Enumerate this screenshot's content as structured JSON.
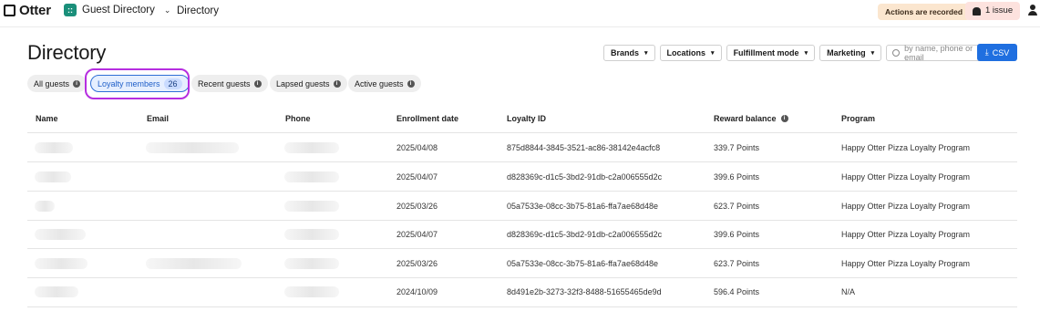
{
  "topbar": {
    "logo_text": "Otter",
    "app_name": "Guest Directory",
    "app_icon_glyph": "::",
    "breadcrumb": "Directory",
    "recorded_label": "Actions are recorded",
    "issue_label": "1 issue"
  },
  "page": {
    "title": "Directory"
  },
  "filters": {
    "brands": "Brands",
    "locations": "Locations",
    "fulfillment": "Fulfillment mode",
    "marketing": "Marketing",
    "search_placeholder": "by name, phone or email",
    "csv_label": "CSV"
  },
  "tabs": [
    {
      "label": "All guests"
    },
    {
      "label": "Loyalty members",
      "count": "26"
    },
    {
      "label": "Recent guests"
    },
    {
      "label": "Lapsed guests"
    },
    {
      "label": "Active guests"
    }
  ],
  "table": {
    "columns": [
      "Name",
      "Email",
      "Phone",
      "Enrollment date",
      "Loyalty ID",
      "Reward balance",
      "Program"
    ],
    "rows": [
      {
        "enrollment_date": "2025/04/08",
        "loyalty_id": "875d8844-3845-3521-ac86-38142e4acfc8",
        "reward_balance": "339.7 Points",
        "program": "Happy Otter Pizza Loyalty Program"
      },
      {
        "enrollment_date": "2025/04/07",
        "loyalty_id": "d828369c-d1c5-3bd2-91db-c2a006555d2c",
        "reward_balance": "399.6 Points",
        "program": "Happy Otter Pizza Loyalty Program"
      },
      {
        "enrollment_date": "2025/03/26",
        "loyalty_id": "05a7533e-08cc-3b75-81a6-ffa7ae68d48e",
        "reward_balance": "623.7 Points",
        "program": "Happy Otter Pizza Loyalty Program"
      },
      {
        "enrollment_date": "2025/04/07",
        "loyalty_id": "d828369c-d1c5-3bd2-91db-c2a006555d2c",
        "reward_balance": "399.6 Points",
        "program": "Happy Otter Pizza Loyalty Program"
      },
      {
        "enrollment_date": "2025/03/26",
        "loyalty_id": "05a7533e-08cc-3b75-81a6-ffa7ae68d48e",
        "reward_balance": "623.7 Points",
        "program": "Happy Otter Pizza Loyalty Program"
      },
      {
        "enrollment_date": "2024/10/09",
        "loyalty_id": "8d491e2b-3273-32f3-8488-51655465de9d",
        "reward_balance": "596.4 Points",
        "program": "N/A"
      }
    ]
  },
  "colors": {
    "accent": "#1f6fe0",
    "highlight": "#b62ee0",
    "recorded_bg": "#fbe6cf",
    "issue_bg": "#fde2de"
  },
  "icons": [
    "otter-logo-icon",
    "guest-directory-app-icon",
    "chevron-down-icon",
    "bell-icon",
    "user-icon",
    "search-icon",
    "download-icon",
    "info-icon"
  ]
}
